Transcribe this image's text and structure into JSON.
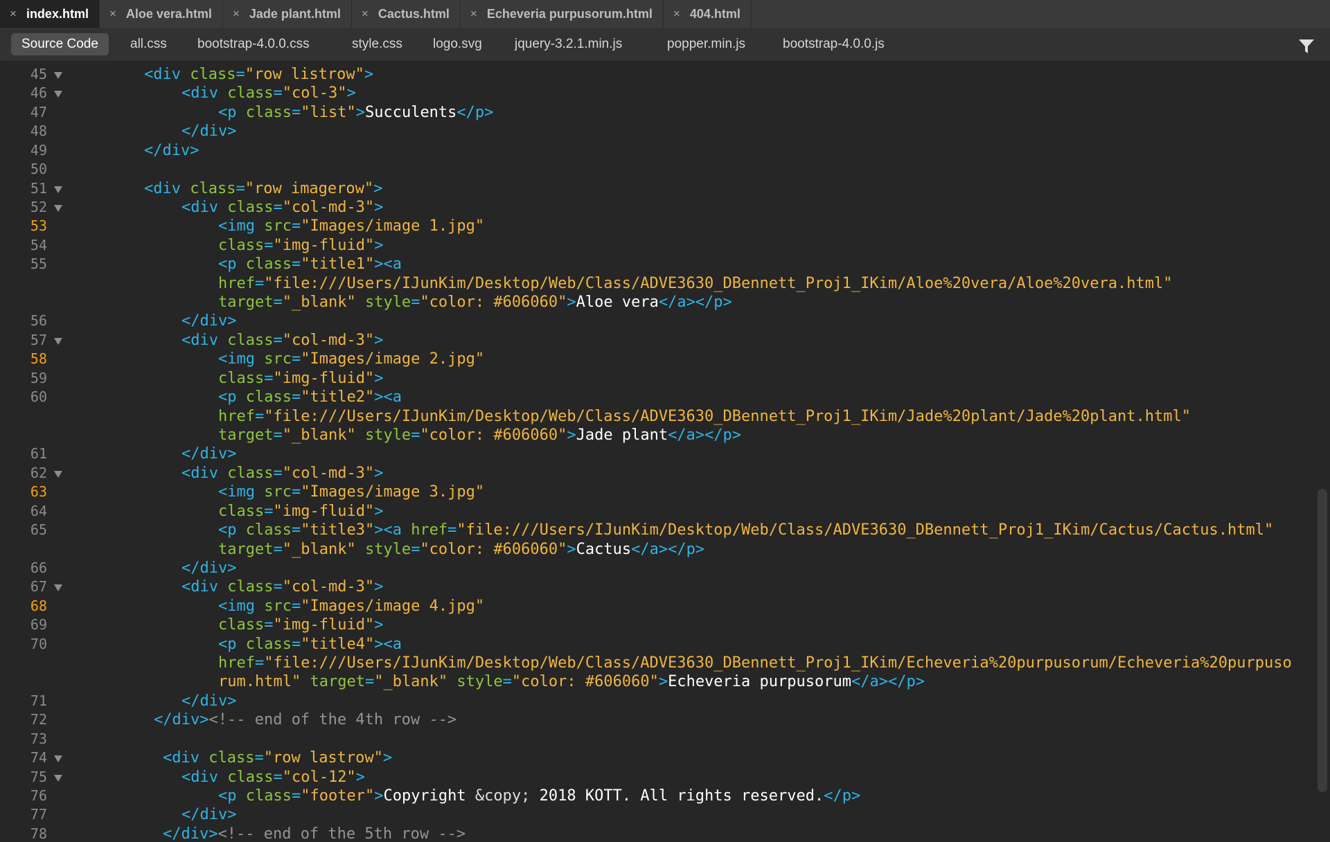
{
  "file_tabs": [
    {
      "label": "index.html",
      "active": true
    },
    {
      "label": "Aloe vera.html",
      "active": false
    },
    {
      "label": "Jade plant.html",
      "active": false
    },
    {
      "label": "Cactus.html",
      "active": false
    },
    {
      "label": "Echeveria purpusorum.html",
      "active": false
    },
    {
      "label": "404.html",
      "active": false
    }
  ],
  "tab_close_glyph": "×",
  "related_files": [
    "Source Code",
    "all.css",
    "bootstrap-4.0.0.css",
    "style.css",
    "logo.svg",
    "jquery-3.2.1.min.js",
    "popper.min.js",
    "bootstrap-4.0.0.js"
  ],
  "icons": {
    "filter": "filter-icon",
    "fold": "fold-triangle-icon"
  },
  "colors": {
    "background": "#262626",
    "tag": "#2fb4e4",
    "attribute": "#8dc63f",
    "string": "#f0b541",
    "text": "#ffffff",
    "comment": "#949494",
    "line_number": "#8b8b8b",
    "modified_line_number": "#f2a019"
  },
  "code_lines": [
    {
      "num": "45",
      "fold": true,
      "modified": false,
      "tokens": [
        [
          "t",
          "<div "
        ],
        [
          "a",
          "class"
        ],
        [
          "t",
          "="
        ],
        [
          "s",
          "\"row listrow\""
        ],
        [
          "t",
          ">"
        ]
      ]
    },
    {
      "num": "46",
      "fold": true,
      "modified": false,
      "tokens": [
        [
          "t",
          "<div "
        ],
        [
          "a",
          "class"
        ],
        [
          "t",
          "="
        ],
        [
          "s",
          "\"col-3\""
        ],
        [
          "t",
          ">"
        ]
      ]
    },
    {
      "num": "47",
      "fold": false,
      "modified": false,
      "tokens": [
        [
          "t",
          "<p "
        ],
        [
          "a",
          "class"
        ],
        [
          "t",
          "="
        ],
        [
          "s",
          "\"list\""
        ],
        [
          "t",
          ">"
        ],
        [
          "x",
          "Succulents"
        ],
        [
          "t",
          "</p>"
        ]
      ]
    },
    {
      "num": "48",
      "fold": false,
      "modified": false,
      "tokens": [
        [
          "t",
          "</div>"
        ]
      ]
    },
    {
      "num": "49",
      "fold": false,
      "modified": false,
      "tokens": [
        [
          "t",
          "</div>"
        ]
      ]
    },
    {
      "num": "50",
      "fold": false,
      "modified": false,
      "tokens": []
    },
    {
      "num": "51",
      "fold": true,
      "modified": false,
      "tokens": [
        [
          "t",
          "<div "
        ],
        [
          "a",
          "class"
        ],
        [
          "t",
          "="
        ],
        [
          "s",
          "\"row imagerow\""
        ],
        [
          "t",
          ">"
        ]
      ]
    },
    {
      "num": "52",
      "fold": true,
      "modified": false,
      "tokens": [
        [
          "t",
          "<div "
        ],
        [
          "a",
          "class"
        ],
        [
          "t",
          "="
        ],
        [
          "s",
          "\"col-md-3\""
        ],
        [
          "t",
          ">"
        ]
      ]
    },
    {
      "num": "53",
      "fold": false,
      "modified": true,
      "tokens": [
        [
          "t",
          "<img "
        ],
        [
          "a",
          "src"
        ],
        [
          "t",
          "="
        ],
        [
          "s",
          "\"Images/image 1.jpg\""
        ]
      ]
    },
    {
      "num": "54",
      "fold": false,
      "modified": false,
      "tokens": [
        [
          "a",
          "class"
        ],
        [
          "t",
          "="
        ],
        [
          "s",
          "\"img-fluid\""
        ],
        [
          "t",
          ">"
        ]
      ]
    },
    {
      "num": "55",
      "fold": false,
      "modified": false,
      "tokens": [
        [
          "t",
          "<p "
        ],
        [
          "a",
          "class"
        ],
        [
          "t",
          "="
        ],
        [
          "s",
          "\"title1\""
        ],
        [
          "t",
          "><a"
        ]
      ]
    },
    {
      "num": "",
      "fold": false,
      "modified": false,
      "tokens": [
        [
          "a",
          "href"
        ],
        [
          "t",
          "="
        ],
        [
          "s",
          "\"file:///Users/IJunKim/Desktop/Web/Class/ADVE3630_DBennett_Proj1_IKim/Aloe%20vera/Aloe%20vera.html\""
        ]
      ]
    },
    {
      "num": "",
      "fold": false,
      "modified": false,
      "tokens": [
        [
          "a",
          "target"
        ],
        [
          "t",
          "="
        ],
        [
          "s",
          "\"_blank\""
        ],
        [
          "t",
          " "
        ],
        [
          "a",
          "style"
        ],
        [
          "t",
          "="
        ],
        [
          "s",
          "\"color: #606060\""
        ],
        [
          "t",
          ">"
        ],
        [
          "x",
          "Aloe vera"
        ],
        [
          "t",
          "</a></p>"
        ]
      ]
    },
    {
      "num": "56",
      "fold": false,
      "modified": false,
      "tokens": [
        [
          "t",
          "</div>"
        ]
      ]
    },
    {
      "num": "57",
      "fold": true,
      "modified": false,
      "tokens": [
        [
          "t",
          "<div "
        ],
        [
          "a",
          "class"
        ],
        [
          "t",
          "="
        ],
        [
          "s",
          "\"col-md-3\""
        ],
        [
          "t",
          ">"
        ]
      ]
    },
    {
      "num": "58",
      "fold": false,
      "modified": true,
      "tokens": [
        [
          "t",
          "<img "
        ],
        [
          "a",
          "src"
        ],
        [
          "t",
          "="
        ],
        [
          "s",
          "\"Images/image 2.jpg\""
        ]
      ]
    },
    {
      "num": "59",
      "fold": false,
      "modified": false,
      "tokens": [
        [
          "a",
          "class"
        ],
        [
          "t",
          "="
        ],
        [
          "s",
          "\"img-fluid\""
        ],
        [
          "t",
          ">"
        ]
      ]
    },
    {
      "num": "60",
      "fold": false,
      "modified": false,
      "tokens": [
        [
          "t",
          "<p "
        ],
        [
          "a",
          "class"
        ],
        [
          "t",
          "="
        ],
        [
          "s",
          "\"title2\""
        ],
        [
          "t",
          "><a"
        ]
      ]
    },
    {
      "num": "",
      "fold": false,
      "modified": false,
      "tokens": [
        [
          "a",
          "href"
        ],
        [
          "t",
          "="
        ],
        [
          "s",
          "\"file:///Users/IJunKim/Desktop/Web/Class/ADVE3630_DBennett_Proj1_IKim/Jade%20plant/Jade%20plant.html\""
        ]
      ]
    },
    {
      "num": "",
      "fold": false,
      "modified": false,
      "tokens": [
        [
          "a",
          "target"
        ],
        [
          "t",
          "="
        ],
        [
          "s",
          "\"_blank\""
        ],
        [
          "t",
          " "
        ],
        [
          "a",
          "style"
        ],
        [
          "t",
          "="
        ],
        [
          "s",
          "\"color: #606060\""
        ],
        [
          "t",
          ">"
        ],
        [
          "x",
          "Jade plant"
        ],
        [
          "t",
          "</a></p>"
        ]
      ]
    },
    {
      "num": "61",
      "fold": false,
      "modified": false,
      "tokens": [
        [
          "t",
          "</div>"
        ]
      ]
    },
    {
      "num": "62",
      "fold": true,
      "modified": false,
      "tokens": [
        [
          "t",
          "<div "
        ],
        [
          "a",
          "class"
        ],
        [
          "t",
          "="
        ],
        [
          "s",
          "\"col-md-3\""
        ],
        [
          "t",
          ">"
        ]
      ]
    },
    {
      "num": "63",
      "fold": false,
      "modified": true,
      "tokens": [
        [
          "t",
          "<img "
        ],
        [
          "a",
          "src"
        ],
        [
          "t",
          "="
        ],
        [
          "s",
          "\"Images/image 3.jpg\""
        ]
      ]
    },
    {
      "num": "64",
      "fold": false,
      "modified": false,
      "tokens": [
        [
          "a",
          "class"
        ],
        [
          "t",
          "="
        ],
        [
          "s",
          "\"img-fluid\""
        ],
        [
          "t",
          ">"
        ]
      ]
    },
    {
      "num": "65",
      "fold": false,
      "modified": false,
      "tokens": [
        [
          "t",
          "<p "
        ],
        [
          "a",
          "class"
        ],
        [
          "t",
          "="
        ],
        [
          "s",
          "\"title3\""
        ],
        [
          "t",
          "><a "
        ],
        [
          "a",
          "href"
        ],
        [
          "t",
          "="
        ],
        [
          "s",
          "\"file:///Users/IJunKim/Desktop/Web/Class/ADVE3630_DBennett_Proj1_IKim/Cactus/Cactus.html\""
        ]
      ]
    },
    {
      "num": "",
      "fold": false,
      "modified": false,
      "tokens": [
        [
          "a",
          "target"
        ],
        [
          "t",
          "="
        ],
        [
          "s",
          "\"_blank\""
        ],
        [
          "t",
          " "
        ],
        [
          "a",
          "style"
        ],
        [
          "t",
          "="
        ],
        [
          "s",
          "\"color: #606060\""
        ],
        [
          "t",
          ">"
        ],
        [
          "x",
          "Cactus"
        ],
        [
          "t",
          "</a></p>"
        ]
      ]
    },
    {
      "num": "66",
      "fold": false,
      "modified": false,
      "tokens": [
        [
          "t",
          "</div>"
        ]
      ]
    },
    {
      "num": "67",
      "fold": true,
      "modified": false,
      "tokens": [
        [
          "t",
          "<div "
        ],
        [
          "a",
          "class"
        ],
        [
          "t",
          "="
        ],
        [
          "s",
          "\"col-md-3\""
        ],
        [
          "t",
          ">"
        ]
      ]
    },
    {
      "num": "68",
      "fold": false,
      "modified": true,
      "tokens": [
        [
          "t",
          "<img "
        ],
        [
          "a",
          "src"
        ],
        [
          "t",
          "="
        ],
        [
          "s",
          "\"Images/image 4.jpg\""
        ]
      ]
    },
    {
      "num": "69",
      "fold": false,
      "modified": false,
      "tokens": [
        [
          "a",
          "class"
        ],
        [
          "t",
          "="
        ],
        [
          "s",
          "\"img-fluid\""
        ],
        [
          "t",
          ">"
        ]
      ]
    },
    {
      "num": "70",
      "fold": false,
      "modified": false,
      "tokens": [
        [
          "t",
          "<p "
        ],
        [
          "a",
          "class"
        ],
        [
          "t",
          "="
        ],
        [
          "s",
          "\"title4\""
        ],
        [
          "t",
          "><a"
        ]
      ]
    },
    {
      "num": "",
      "fold": false,
      "modified": false,
      "tokens": [
        [
          "a",
          "href"
        ],
        [
          "t",
          "="
        ],
        [
          "s",
          "\"file:///Users/IJunKim/Desktop/Web/Class/ADVE3630_DBennett_Proj1_IKim/Echeveria%20purpusorum/Echeveria%20purpuso"
        ]
      ]
    },
    {
      "num": "",
      "fold": false,
      "modified": false,
      "tokens": [
        [
          "s",
          "rum.html\""
        ],
        [
          "t",
          " "
        ],
        [
          "a",
          "target"
        ],
        [
          "t",
          "="
        ],
        [
          "s",
          "\"_blank\""
        ],
        [
          "t",
          " "
        ],
        [
          "a",
          "style"
        ],
        [
          "t",
          "="
        ],
        [
          "s",
          "\"color: #606060\""
        ],
        [
          "t",
          ">"
        ],
        [
          "x",
          "Echeveria purpusorum"
        ],
        [
          "t",
          "</a></p>"
        ]
      ]
    },
    {
      "num": "71",
      "fold": false,
      "modified": false,
      "tokens": [
        [
          "t",
          "</div>"
        ]
      ]
    },
    {
      "num": "72",
      "fold": false,
      "modified": false,
      "tokens": [
        [
          "t",
          "</div>"
        ],
        [
          "c",
          "<!-- end of the 4th row -->"
        ]
      ]
    },
    {
      "num": "73",
      "fold": false,
      "modified": false,
      "tokens": []
    },
    {
      "num": "74",
      "fold": true,
      "modified": false,
      "tokens": [
        [
          "t",
          "<div "
        ],
        [
          "a",
          "class"
        ],
        [
          "t",
          "="
        ],
        [
          "s",
          "\"row lastrow\""
        ],
        [
          "t",
          ">"
        ]
      ]
    },
    {
      "num": "75",
      "fold": true,
      "modified": false,
      "tokens": [
        [
          "t",
          "<div "
        ],
        [
          "a",
          "class"
        ],
        [
          "t",
          "="
        ],
        [
          "s",
          "\"col-12\""
        ],
        [
          "t",
          ">"
        ]
      ]
    },
    {
      "num": "76",
      "fold": false,
      "modified": false,
      "tokens": [
        [
          "t",
          "<p "
        ],
        [
          "a",
          "class"
        ],
        [
          "t",
          "="
        ],
        [
          "s",
          "\"footer\""
        ],
        [
          "t",
          ">"
        ],
        [
          "x",
          "Copyright "
        ],
        [
          "e",
          "&copy;"
        ],
        [
          "x",
          " 2018 KOTT. All rights reserved."
        ],
        [
          "t",
          "</p>"
        ]
      ]
    },
    {
      "num": "77",
      "fold": false,
      "modified": false,
      "tokens": [
        [
          "t",
          "</div>"
        ]
      ]
    },
    {
      "num": "78",
      "fold": false,
      "modified": false,
      "tokens": [
        [
          "t",
          "</div>"
        ],
        [
          "c",
          "<!-- end of the 5th row -->"
        ]
      ]
    }
  ]
}
